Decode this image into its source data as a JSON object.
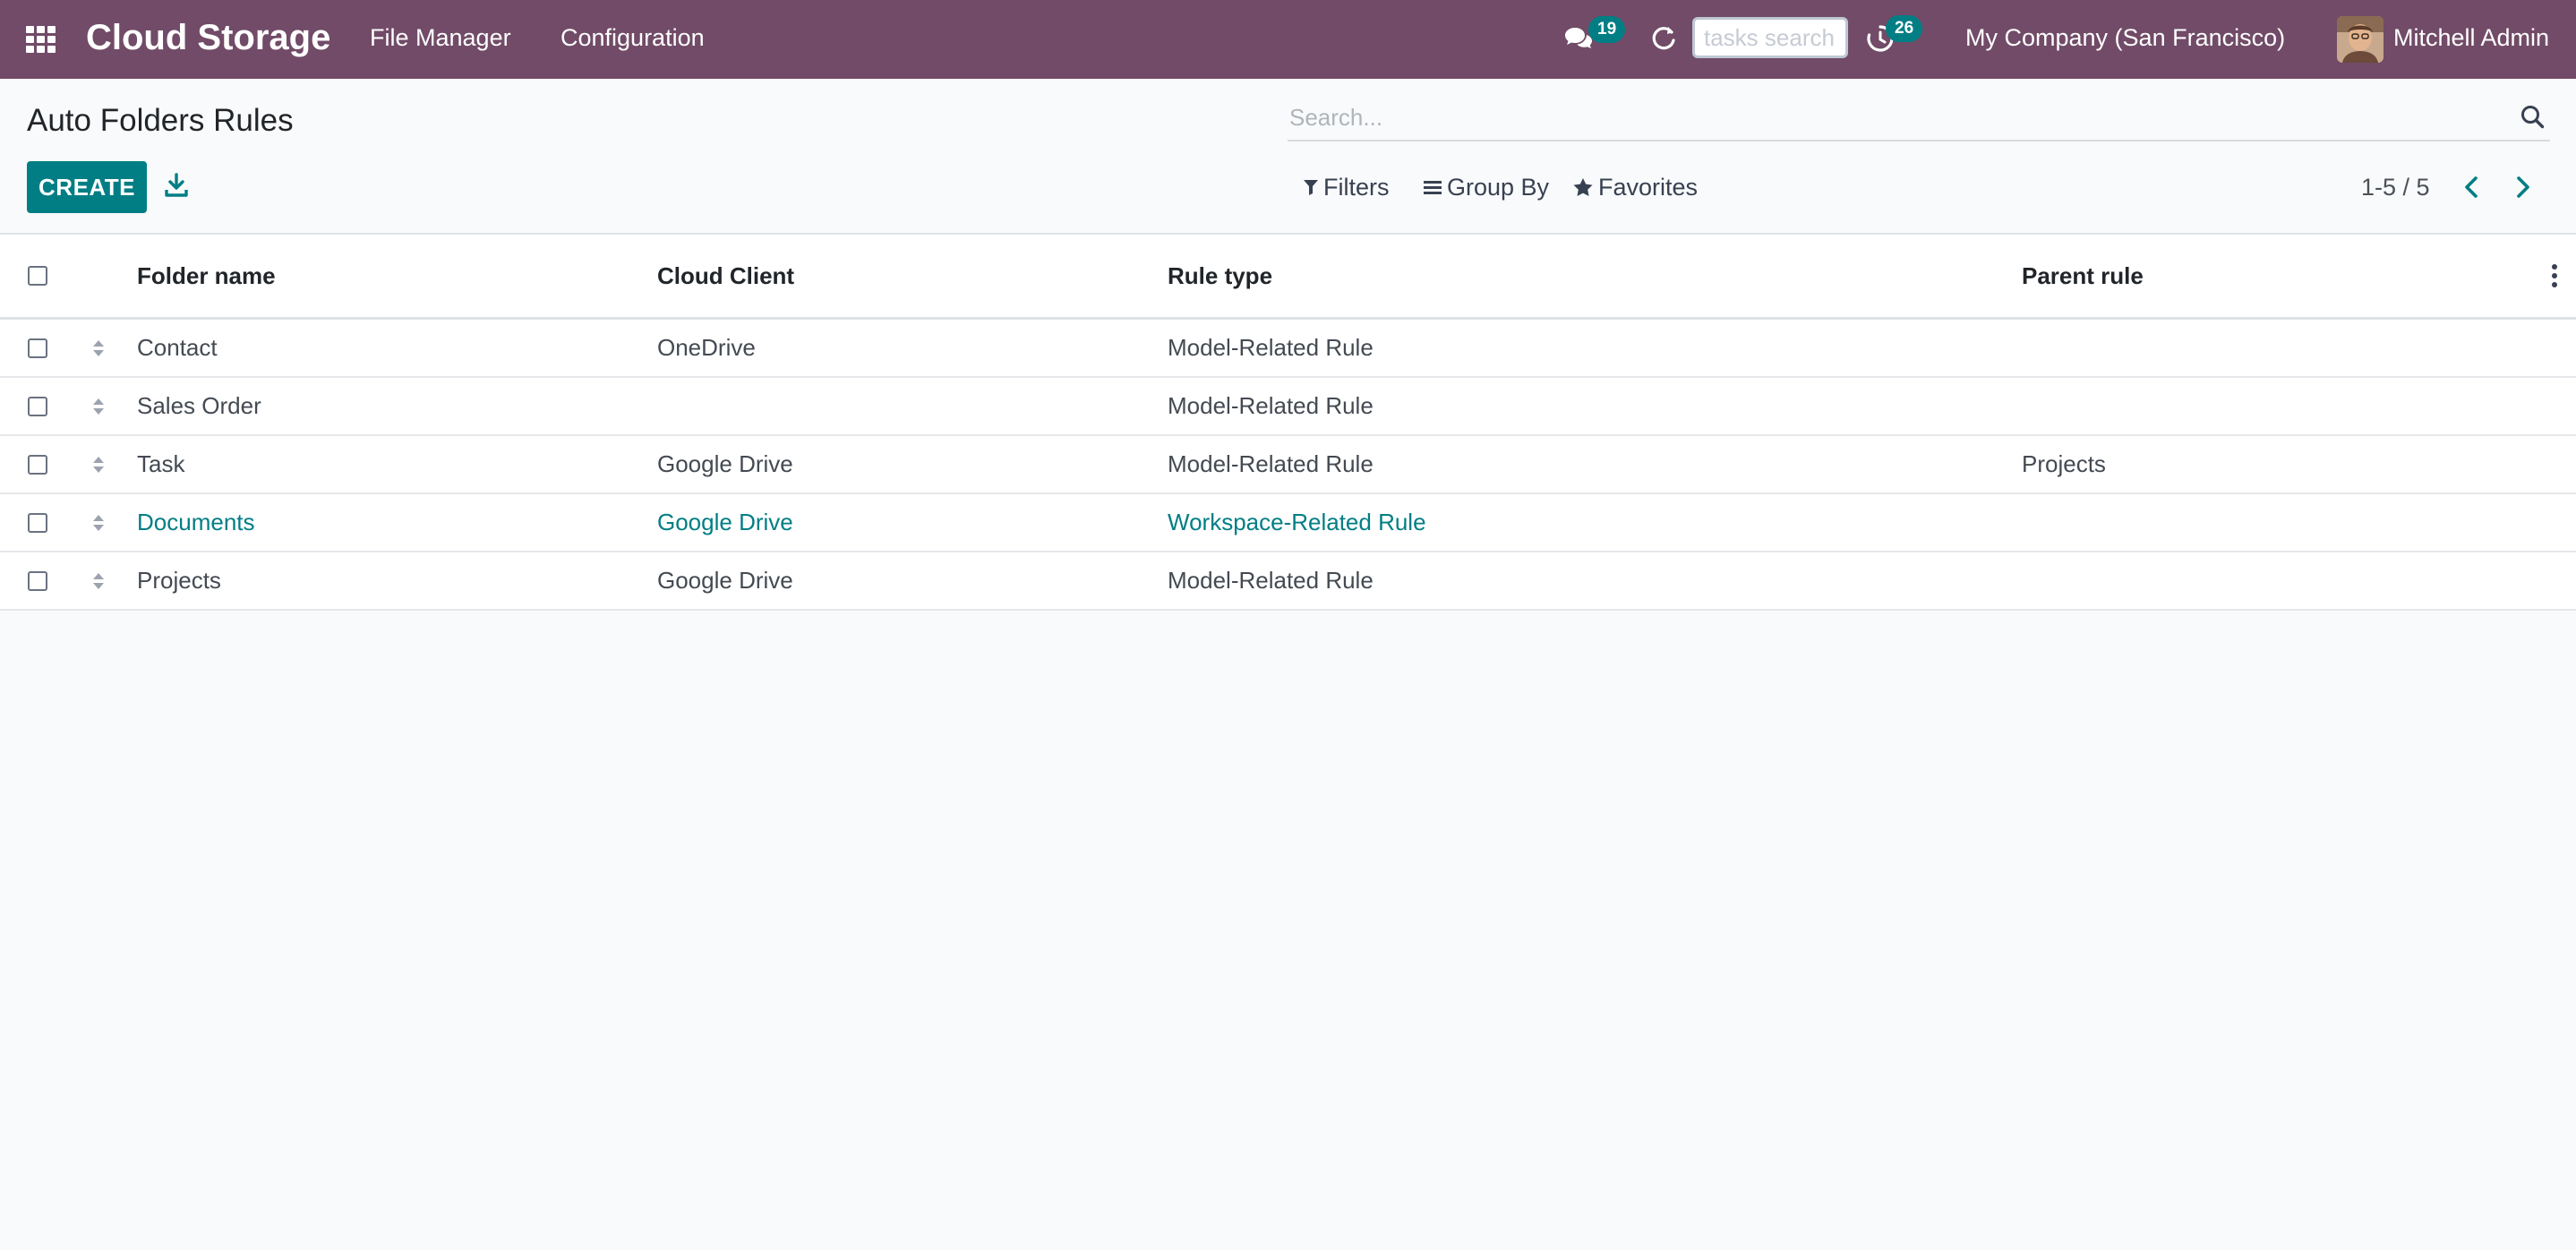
{
  "navbar": {
    "app_title": "Cloud Storage",
    "menu": [
      "File Manager",
      "Configuration"
    ],
    "messages_count": "19",
    "activities_count": "26",
    "tasks_search_placeholder": "tasks search",
    "company": "My Company (San Francisco)",
    "user": "Mitchell Admin"
  },
  "control_panel": {
    "title": "Auto Folders Rules",
    "search_placeholder": "Search...",
    "create_label": "CREATE",
    "filters_label": "Filters",
    "group_by_label": "Group By",
    "favorites_label": "Favorites",
    "pager": "1-5 / 5"
  },
  "table": {
    "headers": [
      "Folder name",
      "Cloud Client",
      "Rule type",
      "Parent rule"
    ],
    "rows": [
      {
        "folder_name": "Contact",
        "cloud_client": "OneDrive",
        "rule_type": "Model-Related Rule",
        "parent_rule": ""
      },
      {
        "folder_name": "Sales Order",
        "cloud_client": "",
        "rule_type": "Model-Related Rule",
        "parent_rule": ""
      },
      {
        "folder_name": "Task",
        "cloud_client": "Google Drive",
        "rule_type": "Model-Related Rule",
        "parent_rule": "Projects"
      },
      {
        "folder_name": "Documents",
        "cloud_client": "Google Drive",
        "rule_type": "Workspace-Related Rule",
        "parent_rule": ""
      },
      {
        "folder_name": "Projects",
        "cloud_client": "Google Drive",
        "rule_type": "Model-Related Rule",
        "parent_rule": ""
      }
    ]
  },
  "colors": {
    "navbar": "#714b67",
    "primary": "#017e84",
    "link": "#017e84"
  },
  "icons": [
    "apps-grid-icon",
    "chat-icon",
    "refresh-icon",
    "activity-clock-icon",
    "search-icon",
    "download-icon",
    "filter-icon",
    "group-by-icon",
    "star-icon",
    "chevron-left-icon",
    "chevron-right-icon",
    "drag-handle-icon",
    "column-options-icon"
  ]
}
